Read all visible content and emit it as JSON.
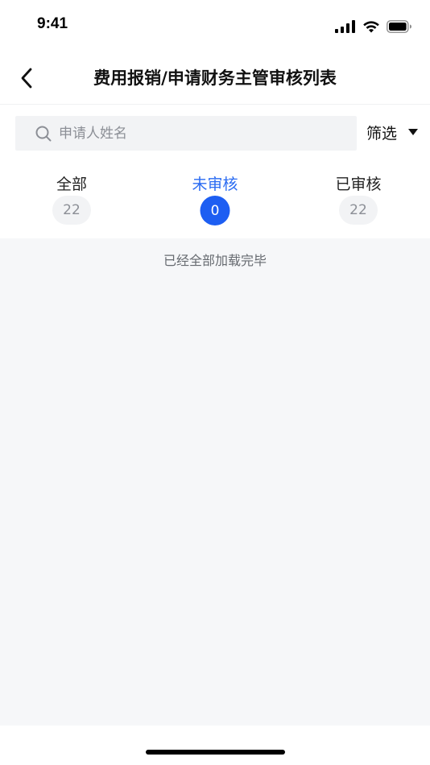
{
  "status_bar": {
    "time": "9:41"
  },
  "nav": {
    "title": "费用报销/申请财务主管审核列表"
  },
  "search": {
    "placeholder": "申请人姓名",
    "value": ""
  },
  "filter": {
    "label": "筛选"
  },
  "tabs": [
    {
      "label": "全部",
      "count": "22",
      "active": false
    },
    {
      "label": "未审核",
      "count": "0",
      "active": true
    },
    {
      "label": "已审核",
      "count": "22",
      "active": false
    }
  ],
  "content": {
    "end_message": "已经全部加载完毕"
  },
  "colors": {
    "accent": "#1d5ef2",
    "accent_text": "#2a6bf2",
    "content_bg": "#f6f7f9",
    "search_bg": "#f2f3f5"
  },
  "icons": {
    "back": "chevron-left-icon",
    "search": "search-icon",
    "filter": "caret-down-icon",
    "signal": "cellular-signal-icon",
    "wifi": "wifi-icon",
    "battery": "battery-icon"
  }
}
